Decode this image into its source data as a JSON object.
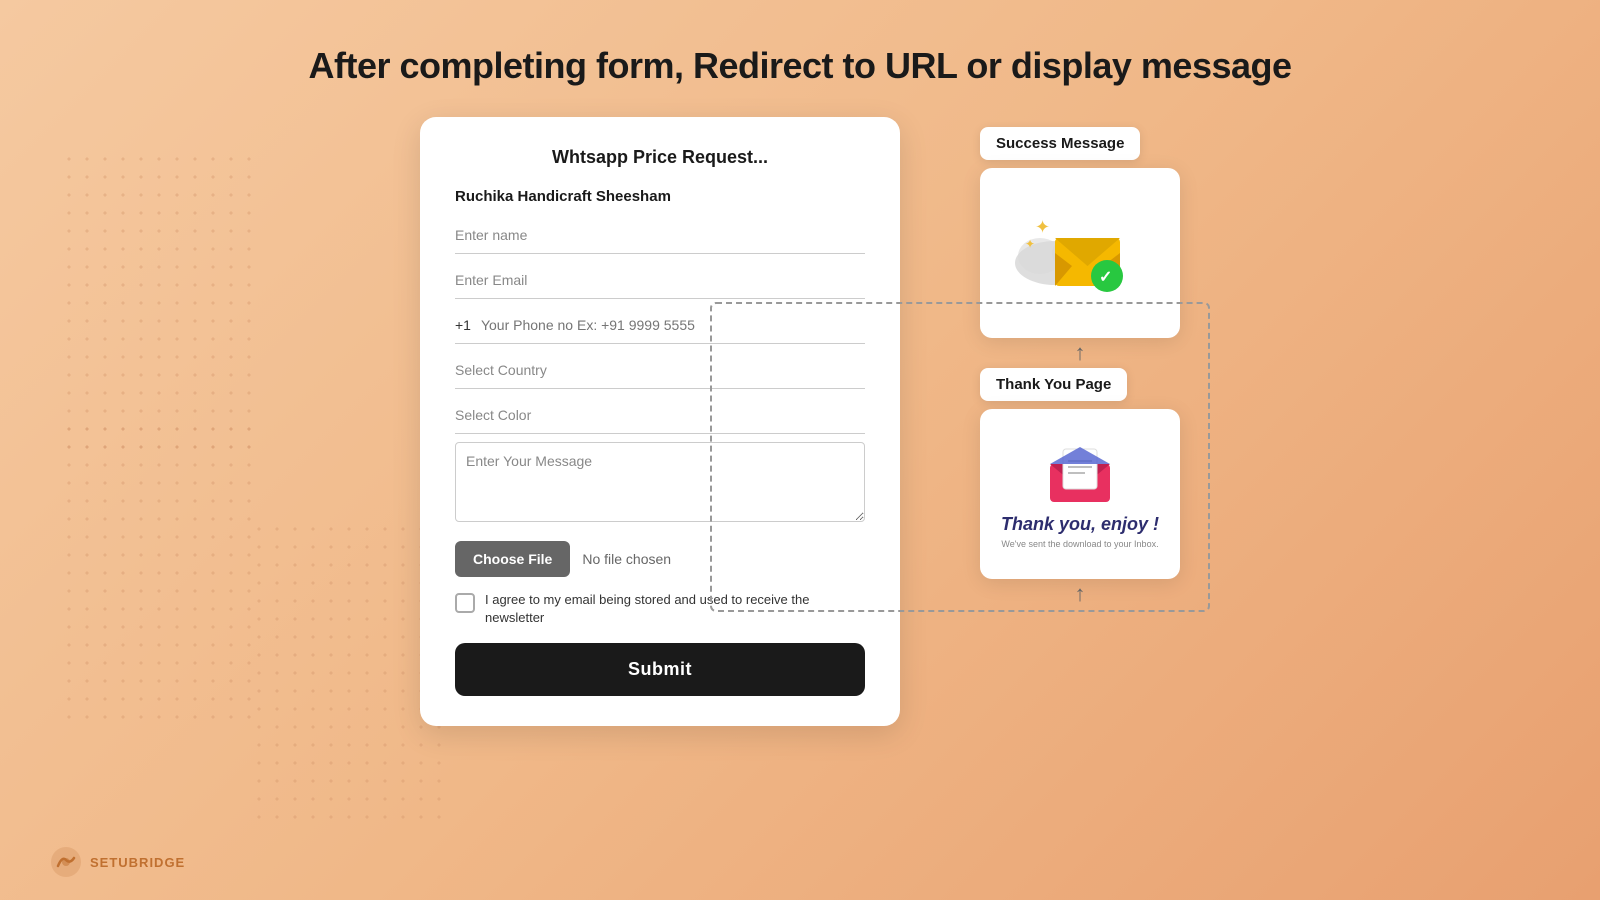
{
  "page": {
    "title": "After completing form, Redirect to URL or display message",
    "background_color": "#f5c4a0"
  },
  "form": {
    "title": "Whtsapp Price Request...",
    "subtitle": "Ruchika Handicraft Sheesham",
    "fields": {
      "name_placeholder": "Enter name",
      "email_placeholder": "Enter Email",
      "phone_prefix": "+1",
      "phone_placeholder": "Your Phone no Ex: +91 9999 5555",
      "country_placeholder": "Select Country",
      "color_placeholder": "Select Color",
      "message_placeholder": "Enter Your Message",
      "choose_file_label": "Choose File",
      "no_file_label": "No file chosen",
      "checkbox_label": "I agree to my email being stored and used to receive the newsletter",
      "submit_label": "Submit"
    }
  },
  "flow": {
    "success_label": "Success Message",
    "thankyou_label": "Thank You Page",
    "thankyou_title": "Thank you, enjoy !",
    "thankyou_subtitle": "We've sent the download to your Inbox."
  },
  "logo": {
    "text": "SETUBRIDGE"
  }
}
